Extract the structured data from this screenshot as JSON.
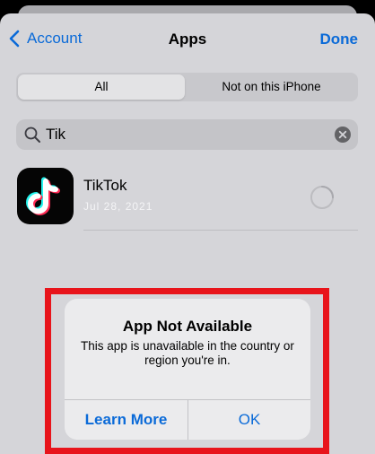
{
  "nav": {
    "back_label": "Account",
    "title": "Apps",
    "done_label": "Done"
  },
  "segments": {
    "all_label": "All",
    "not_on_label": "Not on this iPhone",
    "selected": "All"
  },
  "search": {
    "value": "Tik",
    "placeholder": ""
  },
  "app": {
    "name": "TikTok",
    "date": "Jul 28, 2021",
    "download_progress": 0
  },
  "alert": {
    "title": "App Not Available",
    "message": "This app is unavailable in the country or region you're in.",
    "learn_more_label": "Learn More",
    "ok_label": "OK"
  },
  "colors": {
    "accent": "#0a6ad8",
    "highlight": "#e8141b",
    "sheet_background": "#d5d5d9",
    "alert_background": "#ebebed",
    "tiktok_cyan": "#25f4ee",
    "tiktok_pink": "#fe2c55"
  },
  "icons": {
    "back": "chevron-left-icon",
    "search": "search-icon",
    "clear": "clear-circle-icon",
    "app": "tiktok-logo-icon",
    "spinner": "loading-spinner-icon"
  }
}
